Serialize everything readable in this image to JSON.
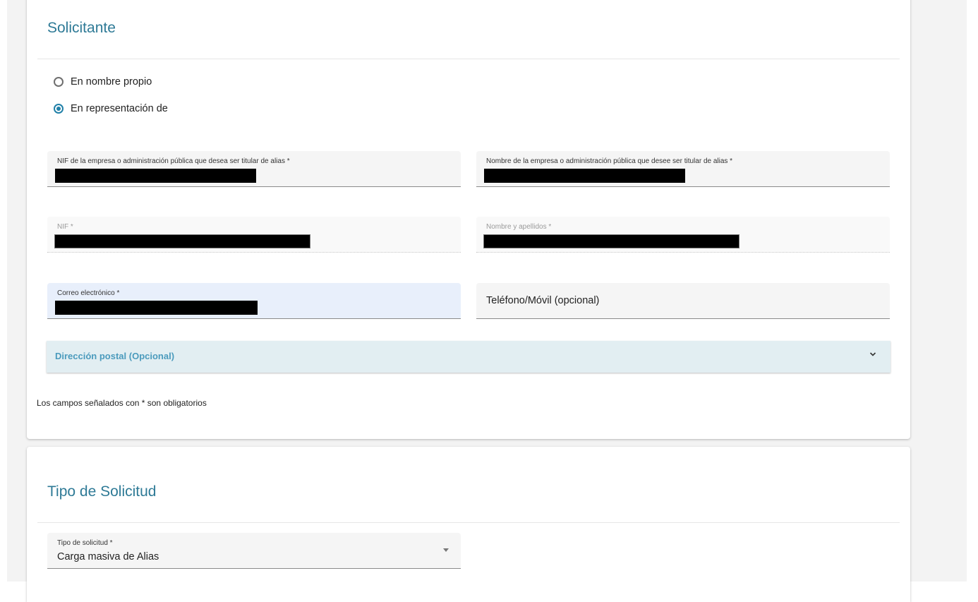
{
  "solicitante": {
    "title": "Solicitante",
    "radios": [
      {
        "label": "En nombre propio",
        "checked": false
      },
      {
        "label": "En representación de",
        "checked": true
      }
    ],
    "fields": {
      "empresa_nif": {
        "label": "NIF de la empresa o administración pública que desea ser titular de alias *",
        "value_redacted": true
      },
      "empresa_nombre": {
        "label": "Nombre de la empresa o administración pública que desee ser titular de alias *",
        "value_redacted": true
      },
      "nif": {
        "label": "NIF *",
        "value_redacted": true,
        "disabled": true
      },
      "nombre_apellidos": {
        "label": "Nombre y apellidos *",
        "value_redacted": true,
        "disabled": true
      },
      "correo": {
        "label": "Correo electrónico *",
        "value_redacted": true,
        "focused": true
      },
      "telefono": {
        "placeholder": "Teléfono/Móvil (opcional)",
        "value": ""
      }
    },
    "accordion": {
      "label": "Dirección postal (Opcional)",
      "expanded": false,
      "icon": "chevron-down-icon"
    },
    "note": "Los campos señalados con * son obligatorios"
  },
  "tipo_solicitud": {
    "title": "Tipo de Solicitud",
    "select": {
      "label": "Tipo de solicitud *",
      "value": "Carga masiva de Alias",
      "icon": "caret-down-icon"
    }
  },
  "colors": {
    "accent": "#2e7a96",
    "radio_checked": "#2180a8",
    "accordion_bg": "#e2eef2",
    "accordion_text": "#4b9bbd",
    "focused_field_bg": "#e8effb"
  }
}
